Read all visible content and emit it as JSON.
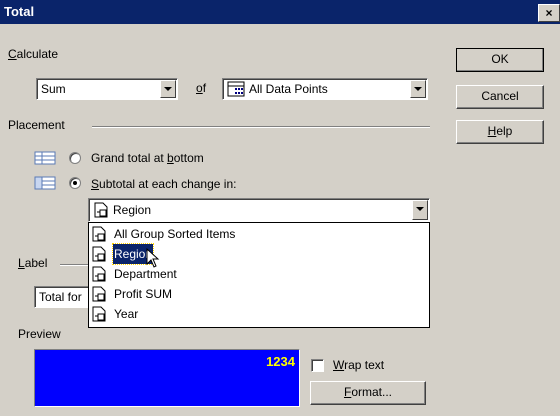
{
  "window": {
    "title": "Total",
    "close_glyph": "×"
  },
  "calculate": {
    "label_prefix": "",
    "label_underline": "C",
    "label_rest": "alculate",
    "function_value": "Sum",
    "of_underline": "o",
    "of_rest": "f",
    "points_value": "All Data Points"
  },
  "placement": {
    "label": "Placement",
    "options": [
      {
        "pre": "Grand total at ",
        "u": "b",
        "post": "ottom",
        "checked": false
      },
      {
        "pre": "",
        "u": "S",
        "post": "ubtotal at each change in:",
        "checked": true
      }
    ],
    "change_in_value": "Region",
    "dropdown_items": [
      "All Group Sorted Items",
      "Region",
      "Department",
      "Profit SUM",
      "Year"
    ],
    "selected_index": 1
  },
  "label_section": {
    "label_underline": "L",
    "label_rest": "abel",
    "value": "Total for"
  },
  "preview": {
    "label": "Preview",
    "number": "1234",
    "colors": {
      "background": "#0000ff",
      "text": "#ffff00"
    }
  },
  "wrap_text": {
    "u": "W",
    "rest": "rap text",
    "checked": false
  },
  "buttons": {
    "ok": "OK",
    "cancel": "Cancel",
    "help_u": "H",
    "help_rest": "elp",
    "format_u": "F",
    "format_rest": "ormat..."
  },
  "icons": {
    "data_points": "grid-icon",
    "grand_total": "grand-total-layout-icon",
    "subtotal": "subtotal-layout-icon",
    "group": "group-item-icon",
    "cursor": "mouse-pointer-icon"
  },
  "accent": "#0a246a"
}
